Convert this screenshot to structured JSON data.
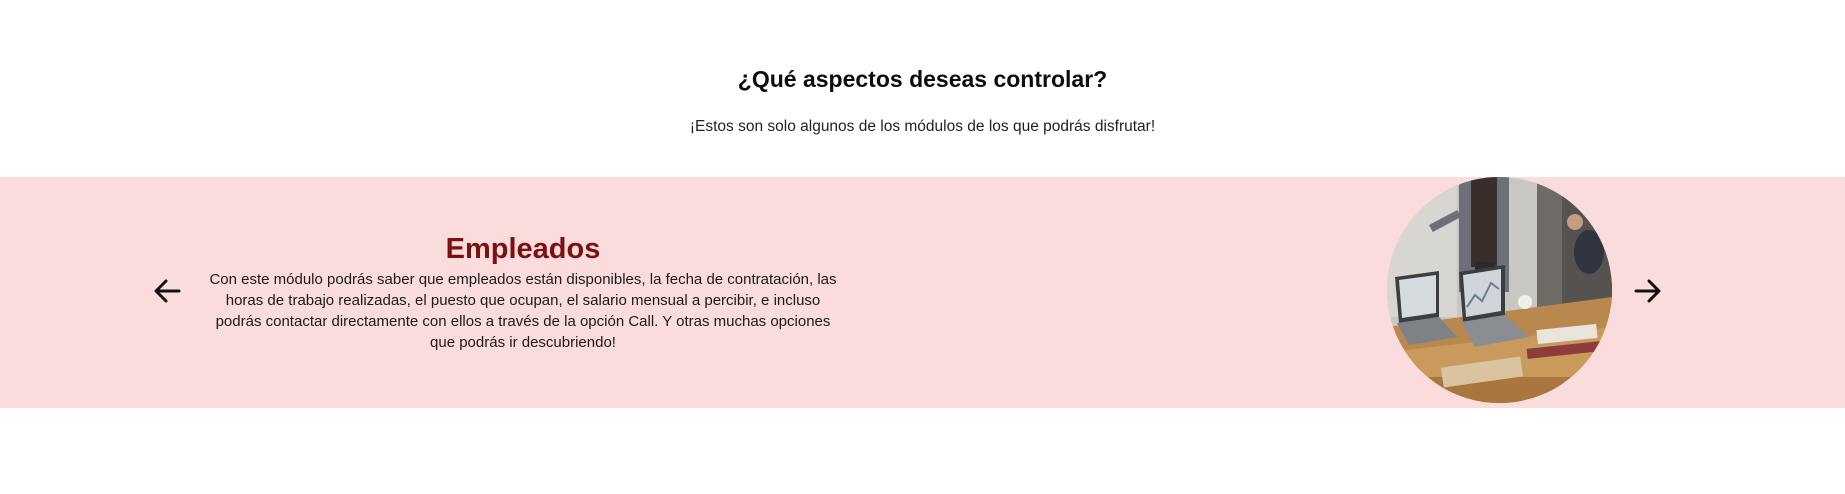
{
  "header": {
    "title": "¿Qué aspectos deseas controlar?",
    "subtitle": "¡Estos son solo algunos de los módulos de los que podrás disfrutar!"
  },
  "carousel": {
    "background_color": "#fbdcdc",
    "title_color": "#7a1010",
    "prev_icon": "arrow-left-icon",
    "next_icon": "arrow-right-icon",
    "slide": {
      "title": "Empleados",
      "description": "Con este módulo podrás saber que empleados están disponibles, la fecha de contratación, las horas de trabajo realizadas, el puesto que ocupan, el salario mensual a percibir, e incluso podrás contactar directamente con ellos a través de la opción Call. Y otras muchas opciones que podrás ir descubriendo!",
      "image": "office-meeting-photo"
    }
  }
}
